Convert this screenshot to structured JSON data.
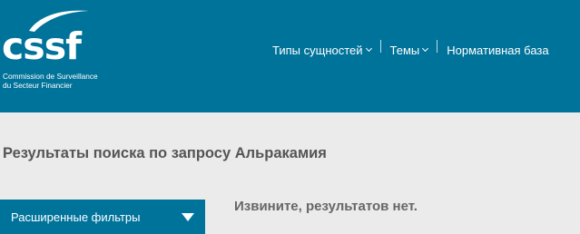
{
  "header": {
    "logo": {
      "wordmark": "cssf",
      "subtitle_line1": "Commission de Surveillance",
      "subtitle_line2": "du Secteur Financier"
    },
    "nav": [
      {
        "label": "Типы сущностей",
        "has_dropdown": true
      },
      {
        "label": "Темы",
        "has_dropdown": true
      },
      {
        "label": "Нормативная база",
        "has_dropdown": false
      }
    ]
  },
  "main": {
    "results_title": "Результаты поиска по запросу Альракамия",
    "filter_button_label": "Расширенные фильтры",
    "no_results_message": "Извините, результатов нет."
  },
  "colors": {
    "brand": "#00739a",
    "background": "#ebebeb",
    "text": "#555555"
  }
}
